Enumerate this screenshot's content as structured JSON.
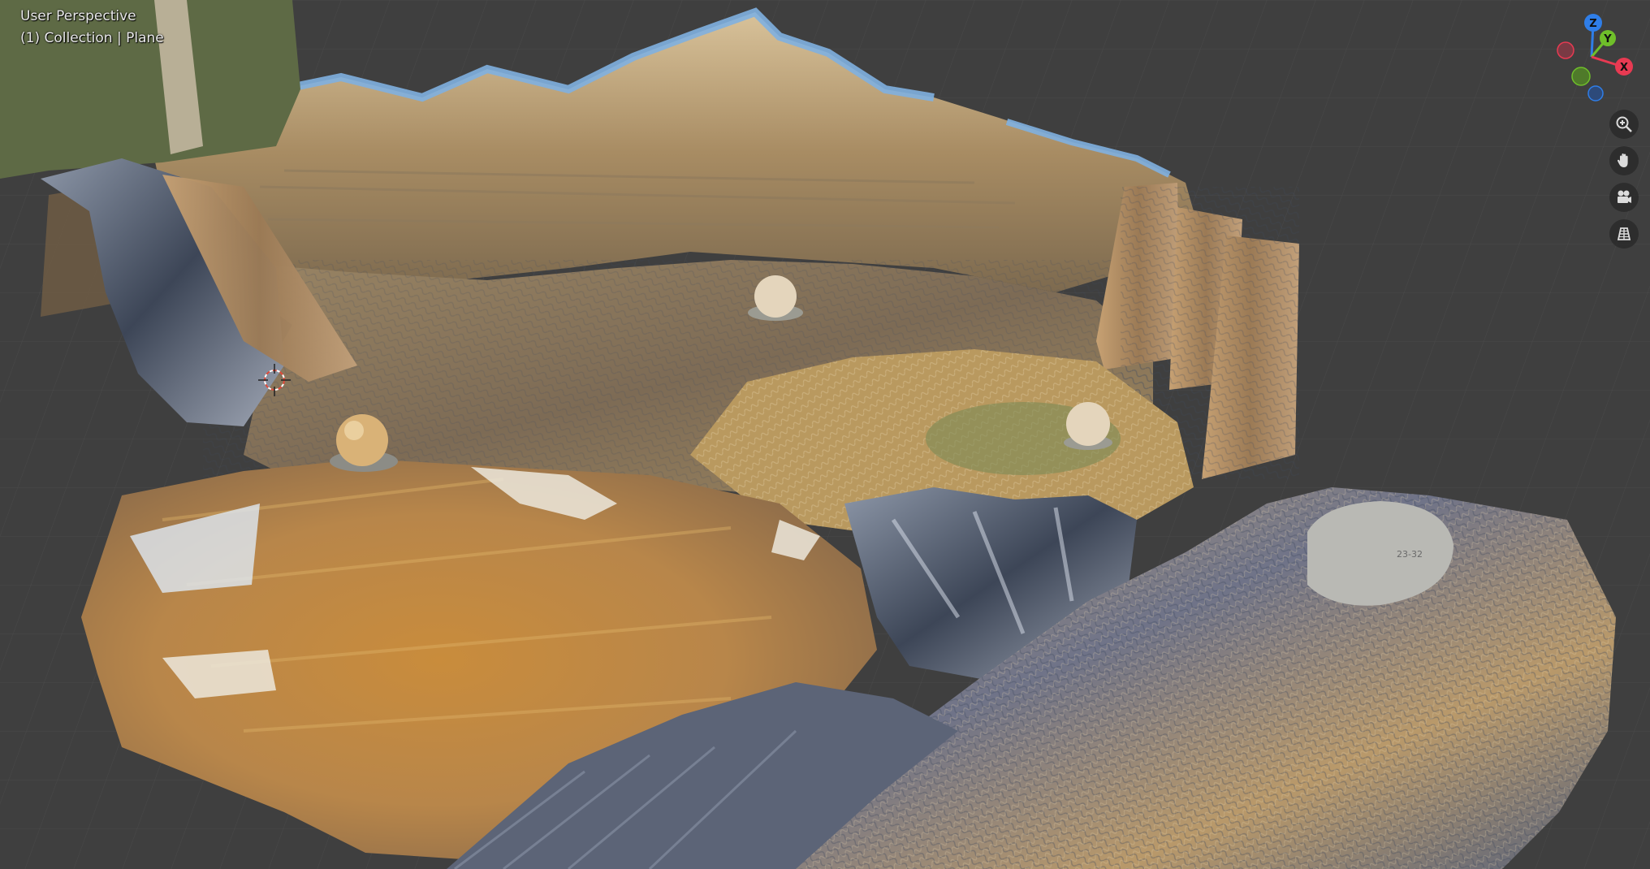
{
  "viewport": {
    "view_name": "User Perspective",
    "collection_info": "(1) Collection | Plane",
    "background_color": "#3f3f3f",
    "grid_color": "#4a4a4a"
  },
  "gizmo": {
    "axes": [
      {
        "label": "Z",
        "color": "#2f7ee8"
      },
      {
        "label": "Y",
        "color": "#6fbf2a"
      },
      {
        "label": "X",
        "color": "#e83a52"
      }
    ]
  },
  "nav_buttons": [
    {
      "name": "zoom",
      "icon": "zoom-in-icon"
    },
    {
      "name": "pan",
      "icon": "hand-icon"
    },
    {
      "name": "camera",
      "icon": "camera-icon"
    },
    {
      "name": "ortho",
      "icon": "grid-icon"
    }
  ],
  "scene": {
    "object": "photogrammetry-scan-mesh",
    "palette": [
      "#c9a56a",
      "#8c7450",
      "#6d84a8",
      "#e2c99d",
      "#4b5a6e",
      "#b7893f"
    ]
  }
}
